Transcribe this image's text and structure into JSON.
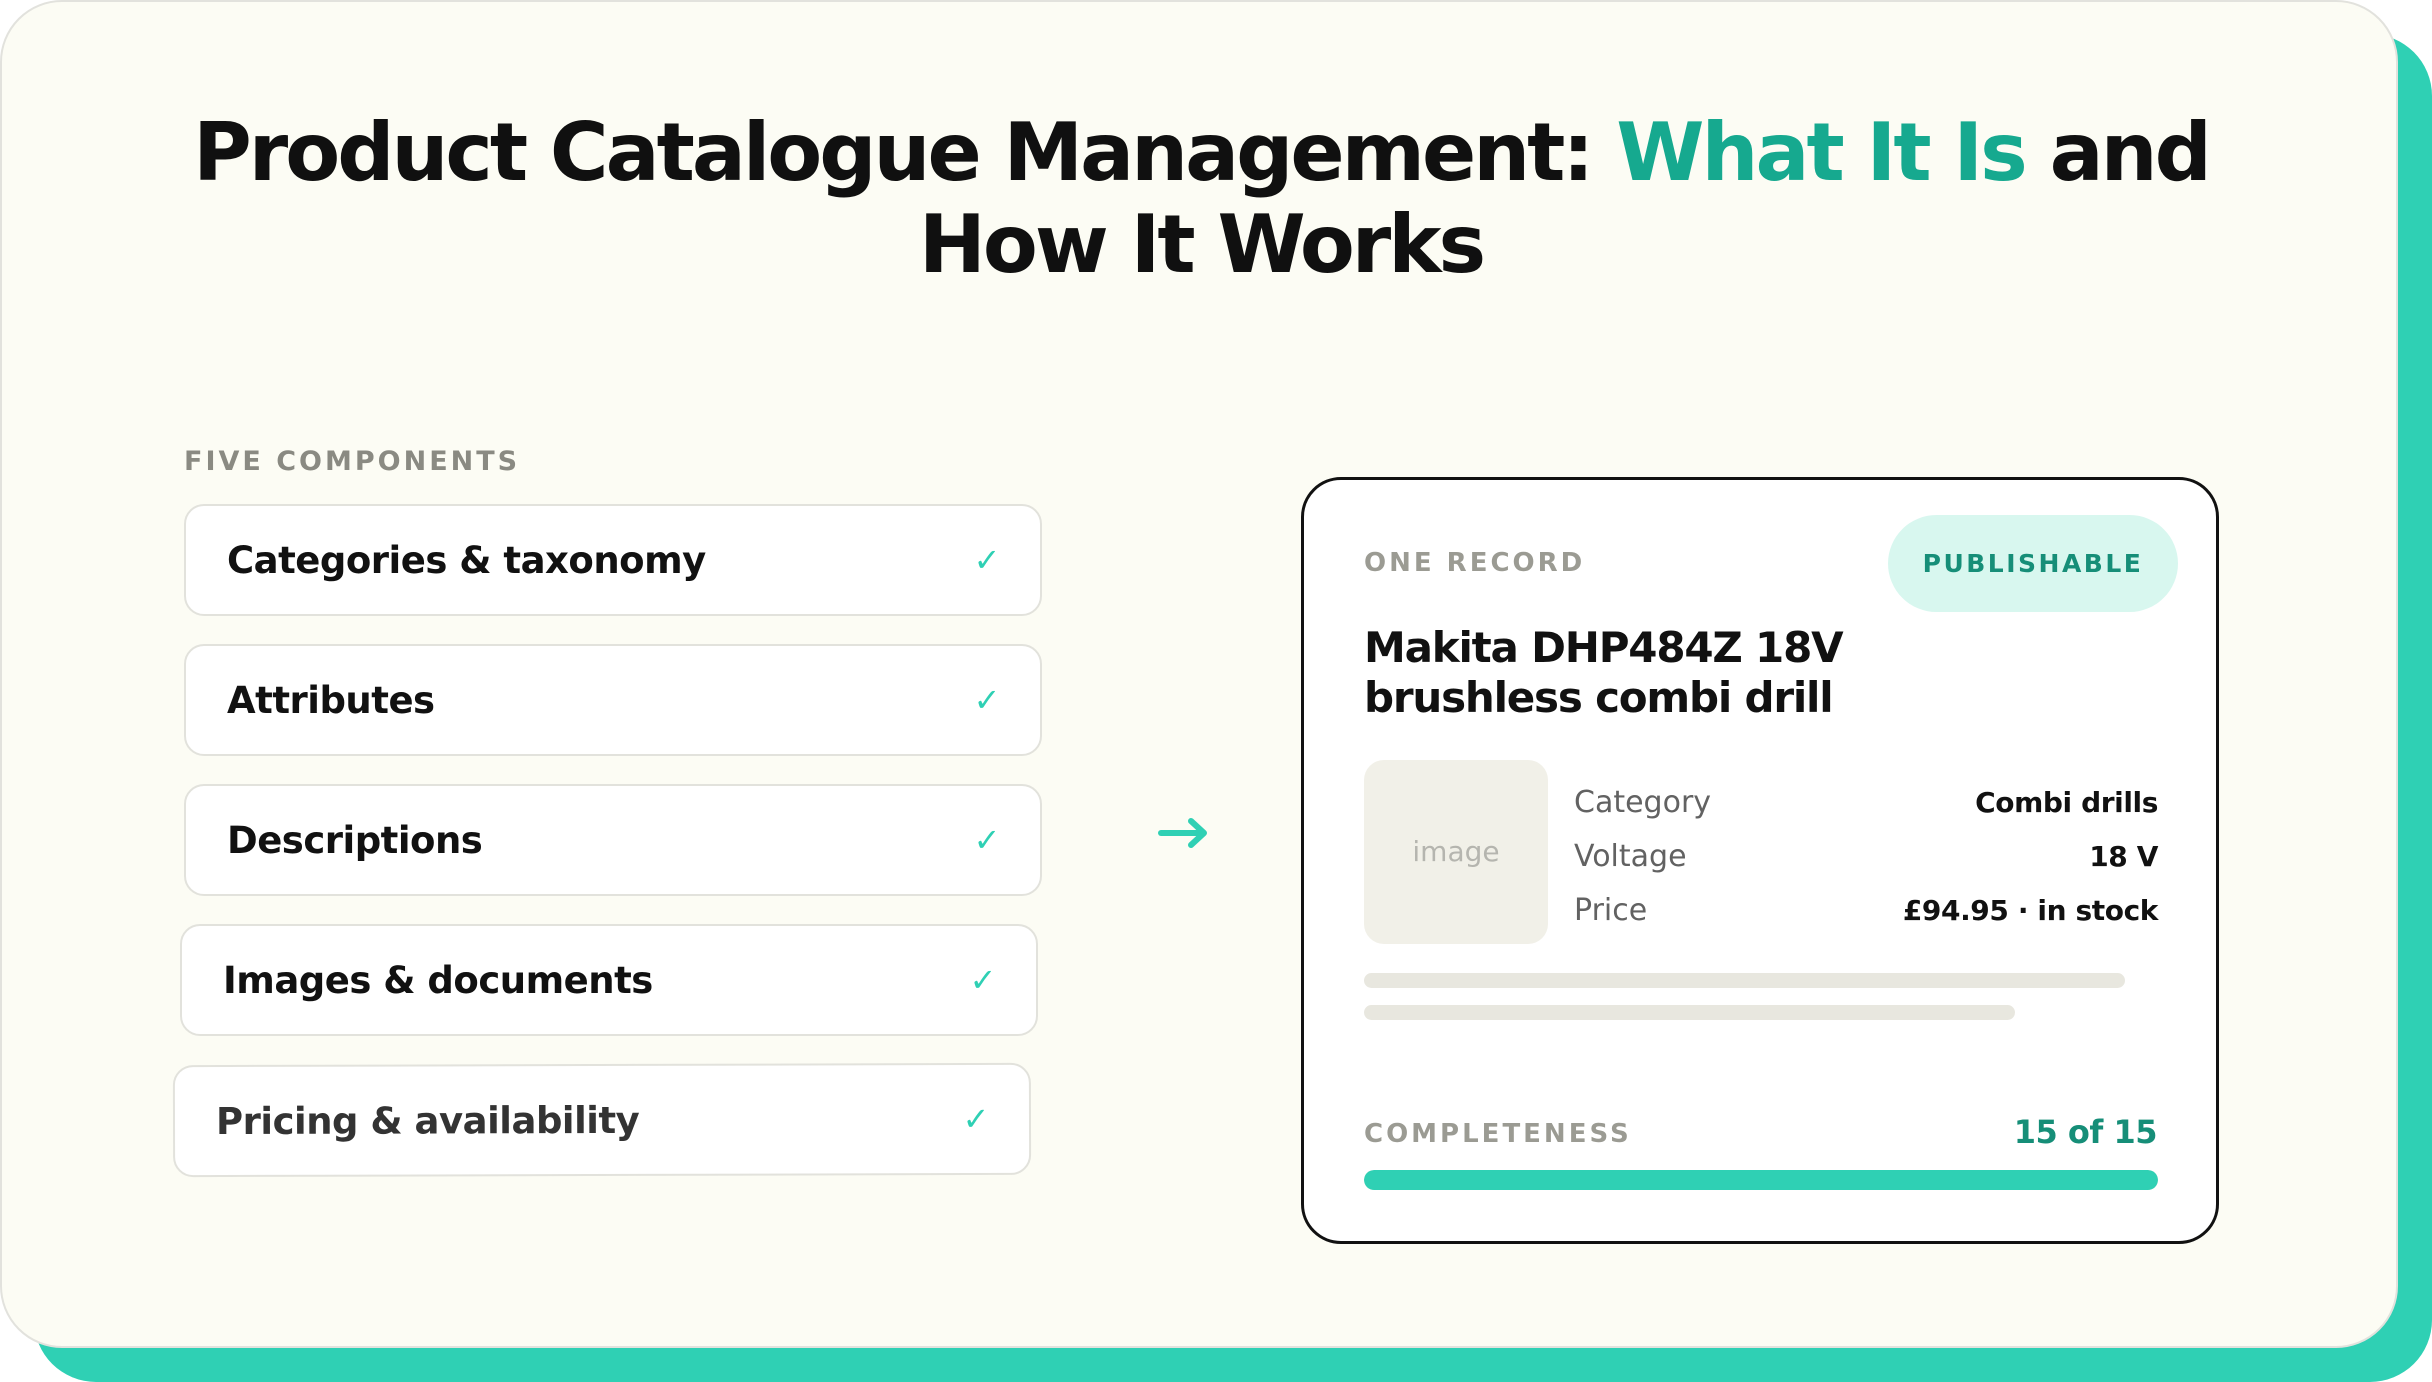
{
  "colors": {
    "accent": "#2fd0b4",
    "accent_dark": "#16a98f",
    "card_background": "#fcfcf4",
    "text": "#111111"
  },
  "headline": {
    "prefix": "Product Catalogue Management:",
    "accent": "What It Is",
    "suffix": "and How It Works"
  },
  "components": {
    "label": "FIVE COMPONENTS",
    "items": [
      {
        "label": "Categories & taxonomy",
        "icon": "check-icon"
      },
      {
        "label": "Attributes",
        "icon": "check-icon"
      },
      {
        "label": "Descriptions",
        "icon": "check-icon"
      },
      {
        "label": "Images & documents",
        "icon": "check-icon"
      },
      {
        "label": "Pricing & availability",
        "icon": "check-icon"
      }
    ]
  },
  "connector": {
    "icon": "right-arrow-icon"
  },
  "record": {
    "label": "ONE RECORD",
    "status": "PUBLISHABLE",
    "title": "Makita DHP484Z 18V brushless combi drill",
    "image_placeholder": "image",
    "attributes": [
      {
        "name": "Category",
        "value": "Combi drills"
      },
      {
        "name": "Voltage",
        "value": "18 V"
      },
      {
        "name": "Price",
        "value": "£94.95 · in stock"
      }
    ],
    "completeness": {
      "label": "COMPLETENESS",
      "value_text": "15 of 15",
      "completed": 15,
      "total": 15
    }
  }
}
